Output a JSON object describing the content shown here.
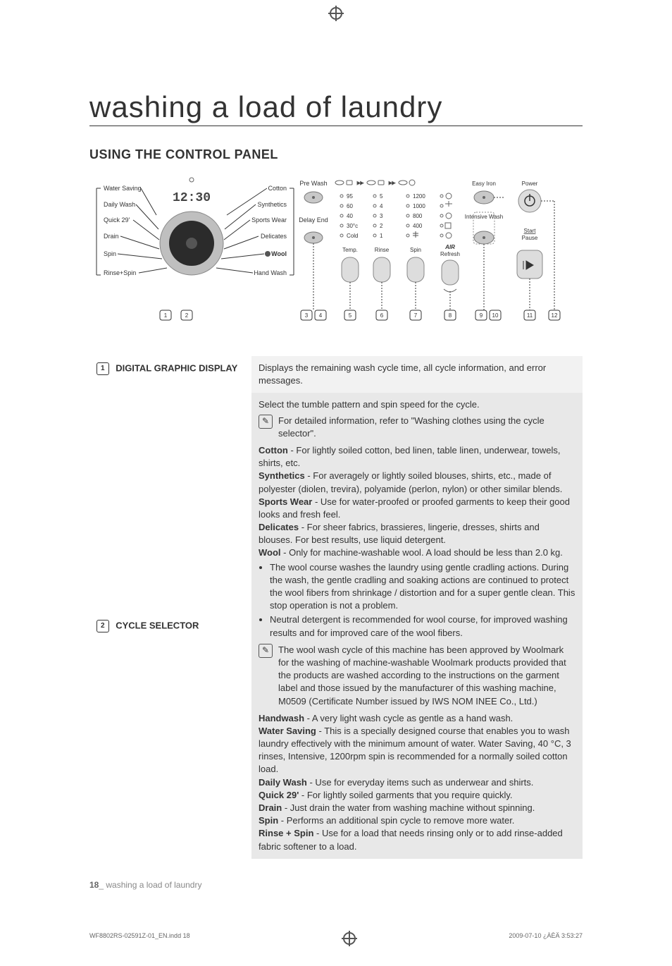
{
  "title": "washing a load of laundry",
  "section": "USING THE CONTROL PANEL",
  "footer_page": "18",
  "footer_text": "washing a load of laundry",
  "print_left": "WF8802RS-02591Z-01_EN.indd   18",
  "print_right": "2009-07-10   ¿ÀÈÄ 3:53:27",
  "panel": {
    "display_time": "12:30",
    "dial_left": [
      "Water Saving",
      "Daily Wash",
      "Quick 29'",
      "Drain",
      "Spin",
      "Rinse+Spin"
    ],
    "dial_right": [
      "Cotton",
      "Synthetics",
      "Sports Wear",
      "Delicates",
      "Wool",
      "Hand Wash"
    ],
    "col3_top": "Pre Wash",
    "col3_mid": "Delay End",
    "col5_label": "Temp.",
    "col5_opts": [
      "95",
      "60",
      "40",
      "30°c",
      "Cold"
    ],
    "col6_label": "Rinse",
    "col6_opts": [
      "5",
      "4",
      "3",
      "2",
      "1"
    ],
    "col7_label": "Spin",
    "col7_opts": [
      "1200",
      "1000",
      "800",
      "400"
    ],
    "col8_top": "AIR",
    "col8_sub": "Refresh",
    "col9a": "Easy Iron",
    "col9b": "Intensive Wash",
    "col11": "Power",
    "col11_btn": "Start Pause",
    "start_label": "Start",
    "pause_label": "Pause",
    "markers": [
      "1",
      "2",
      "3",
      "4",
      "5",
      "6",
      "7",
      "8",
      "9",
      "10",
      "11",
      "12"
    ]
  },
  "rows": [
    {
      "num": "1",
      "title": "DIGITAL GRAPHIC DISPLAY",
      "body_plain": "Displays the remaining wash cycle time, all cycle information, and error messages."
    },
    {
      "num": "2",
      "title": "CYCLE SELECTOR",
      "intro": "Select the tumble pattern and spin speed for the cycle.",
      "note1": "For detailed information, refer to \"Washing clothes using the cycle selector\".",
      "defs": [
        {
          "t": "Cotton",
          "d": " - For lightly soiled cotton, bed linen, table linen, underwear, towels, shirts, etc."
        },
        {
          "t": "Synthetics",
          "d": " - For averagely or lightly soiled blouses, shirts, etc., made of polyester (diolen, trevira), polyamide (perlon, nylon) or other similar blends."
        },
        {
          "t": "Sports Wear",
          "d": " - Use for water-proofed or proofed garments to keep their good looks and fresh feel."
        },
        {
          "t": "Delicates",
          "d": " - For sheer fabrics, brassieres, lingerie, dresses, shirts and blouses. For best results, use liquid detergent."
        },
        {
          "t": "Wool",
          "d": " - Only for machine-washable wool. A load should be less than 2.0 kg."
        }
      ],
      "wool_bullets": [
        "The wool course washes the laundry using gentle cradling actions. During the wash, the gentle cradling and soaking actions are continued to protect the wool fibers from shrinkage / distortion and for a super gentle clean. This stop operation is not a problem.",
        "Neutral detergent is recommended for wool course, for improved washing results and for improved care of the wool fibers."
      ],
      "note2": "The wool wash cycle of this machine has been approved by Woolmark for the washing of machine-washable Woolmark products provided that the products are washed according to the instructions on the garment label and those issued by the manufacturer of this washing machine, M0509 (Certificate Number issued by IWS NOM INEE Co., Ltd.)",
      "defs2": [
        {
          "t": "Handwash",
          "d": " - A very light wash cycle as gentle as a hand wash."
        },
        {
          "t": "Water Saving",
          "d": " - This is a specially designed course that enables you to wash laundry effectively with the minimum amount of water. Water Saving, 40 °C, 3 rinses, Intensive, 1200rpm spin is recommended for a normally soiled cotton load."
        },
        {
          "t": "Daily Wash",
          "d": " - Use for everyday items such as underwear and shirts."
        },
        {
          "t": "Quick 29'",
          "d": " - For lightly soiled garments that you require quickly."
        },
        {
          "t": "Drain",
          "d": " - Just drain the water from washing machine without spinning."
        },
        {
          "t": "Spin",
          "d": " - Performs an additional spin cycle to remove more water."
        },
        {
          "t": "Rinse + Spin",
          "d": " - Use for a load that needs rinsing only or to add rinse-added fabric softener to a load."
        }
      ]
    }
  ]
}
